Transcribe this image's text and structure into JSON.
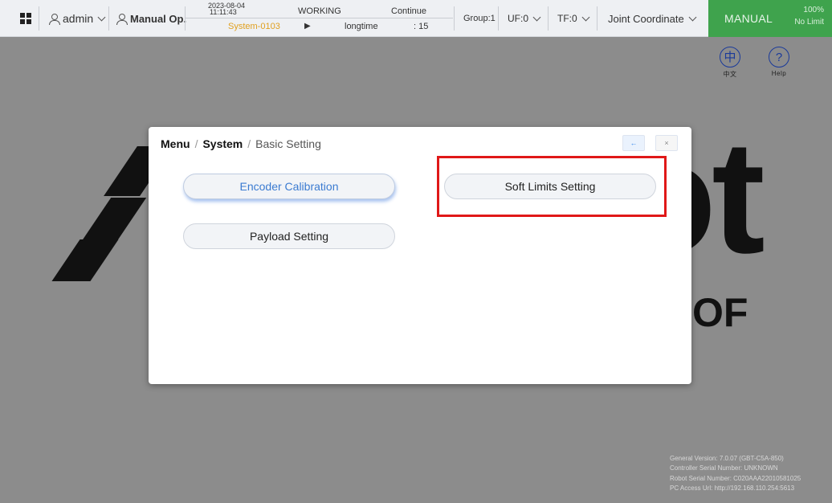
{
  "topbar": {
    "user": "admin",
    "mode": "Manual Op.",
    "status": {
      "date": "2023-08-04",
      "time": "11:11:43",
      "state": "WORKING",
      "action": "Continue",
      "program": "System-0103",
      "run_label": "longtime",
      "run_value": ": 15"
    },
    "group": "Group:1",
    "uf": "UF:0",
    "tf": "TF:0",
    "coordinate": "Joint Coordinate",
    "manual_label": "MANUAL",
    "speed_percent": "100%",
    "speed_limit": "No Limit"
  },
  "tools": {
    "language_glyph": "中",
    "language_label": "中文",
    "help_glyph": "?",
    "help_label": "Help"
  },
  "background": {
    "logo_letters": "ot",
    "logo_sub": "OF"
  },
  "version": {
    "general": "General Version:  7.0.07 (GBT-C5A-850)",
    "controller": "Controller Serial Number:  UNKNOWN",
    "robot": "Robot Serial Number:  C020AAA22010581025",
    "pc": "PC Access Url:  http://192.168.110.254:5613"
  },
  "dialog": {
    "crumb_menu": "Menu",
    "crumb_system": "System",
    "crumb_current": "Basic Setting",
    "back_glyph": "←",
    "close_glyph": "×",
    "items": [
      "Encoder Calibration",
      "Soft Limits Setting",
      "Payload Setting"
    ]
  }
}
